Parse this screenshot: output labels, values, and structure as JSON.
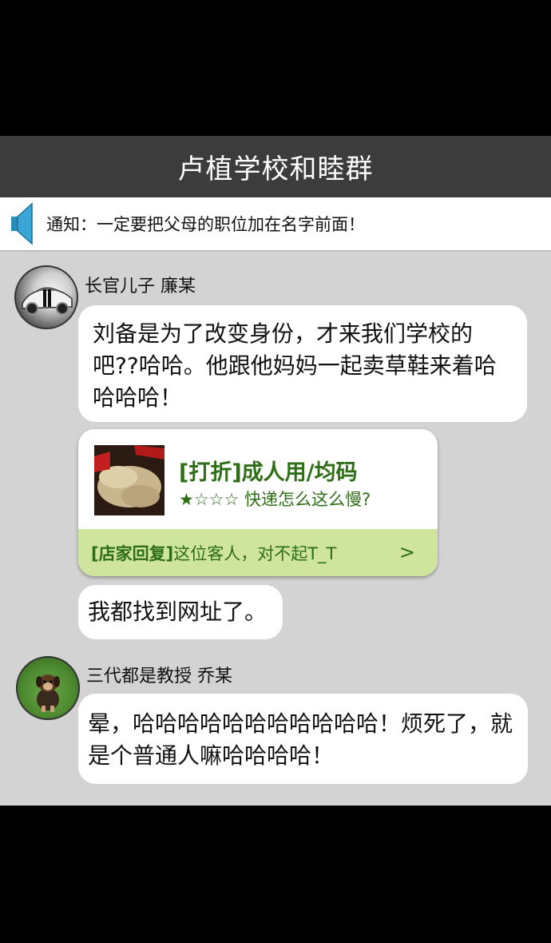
{
  "header": {
    "title": "卢植学校和睦群"
  },
  "notice": {
    "text": "通知：一定要把父母的职位加在名字前面！"
  },
  "messages": [
    {
      "sender": "长官儿子 廉某",
      "bubble_text": "刘备是为了改变身份，才来我们学校的吧??哈哈。他跟他妈妈一起卖草鞋来着哈哈哈哈！",
      "card": {
        "title": "[打折]成人用/均码",
        "rating": "★☆☆☆ 快递怎么这么慢?",
        "reply_tag": "[店家回复]",
        "reply_text": "这位客人，对不起T_T",
        "chevron": ">"
      },
      "followup": "我都找到网址了。"
    },
    {
      "sender": "三代都是教授 乔某",
      "bubble_text": "晕，哈哈哈哈哈哈哈哈哈哈哈！烦死了，就是个普通人嘛哈哈哈哈！"
    }
  ],
  "colors": {
    "header_bg": "#3c3c3c",
    "chat_bg": "#d3d3d3",
    "card_green": "#2d6e16",
    "reply_bg": "#cfe49c"
  },
  "icons": {
    "notice": "speaker-icon"
  }
}
